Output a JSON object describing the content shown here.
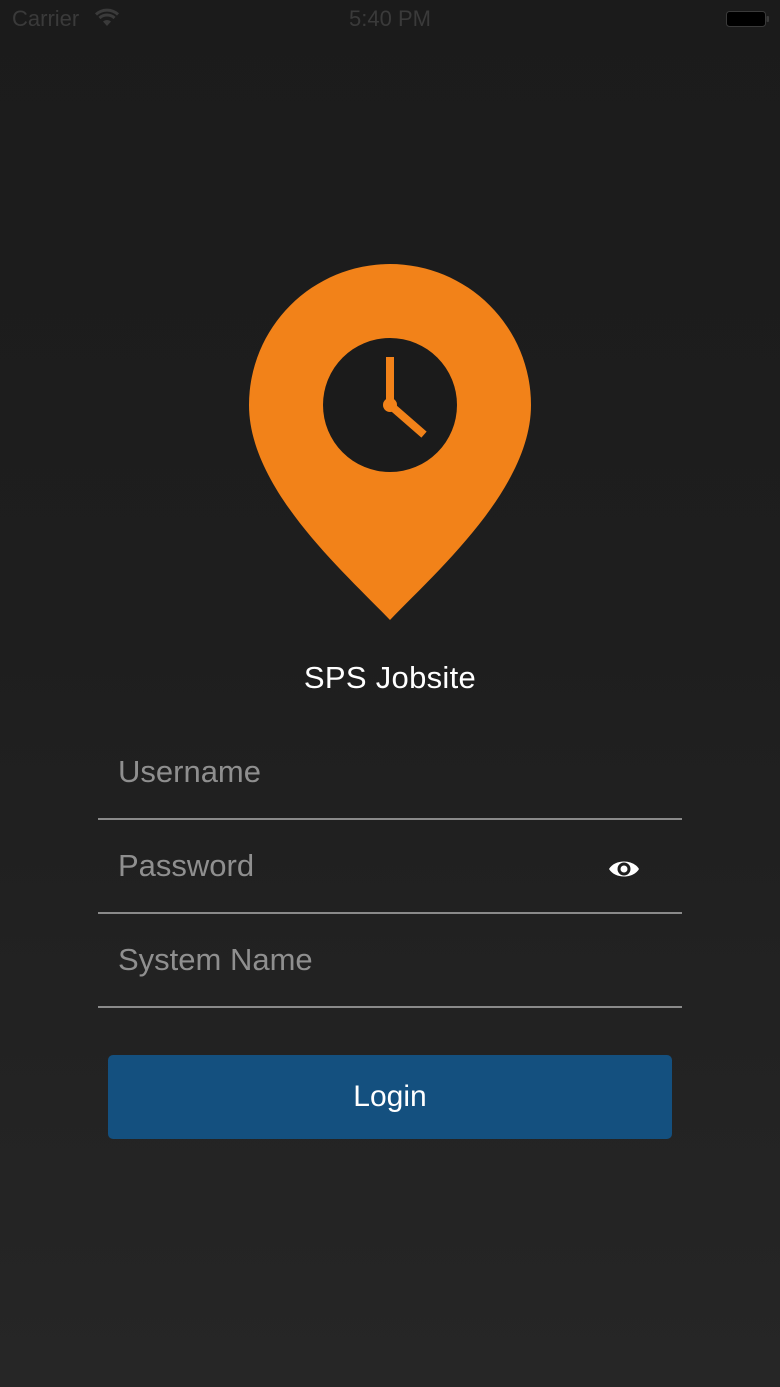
{
  "status_bar": {
    "carrier": "Carrier",
    "time": "5:40 PM",
    "wifi_icon": "wifi-icon",
    "battery_icon": "battery-icon"
  },
  "logo": {
    "icon": "location-pin-clock-icon",
    "color": "#f28219"
  },
  "app_title": "SPS Jobsite",
  "form": {
    "username_placeholder": "Username",
    "username_value": "",
    "password_placeholder": "Password",
    "password_value": "",
    "password_toggle_icon": "eye-icon",
    "system_name_placeholder": "System Name",
    "system_name_value": ""
  },
  "login_button": {
    "label": "Login",
    "color": "#14507f"
  }
}
